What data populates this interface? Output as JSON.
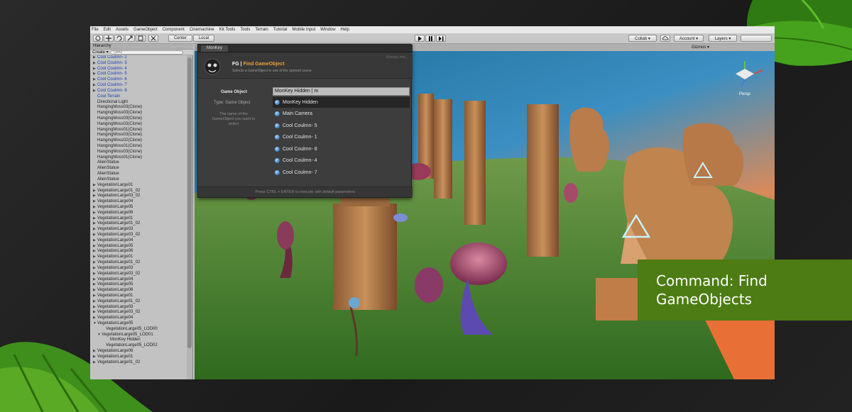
{
  "menubar": {
    "items": [
      "File",
      "Edit",
      "Assets",
      "GameObject",
      "Component",
      "Cinemachine",
      "Kit Tools",
      "Tools",
      "Terrain",
      "Tutorial",
      "Mobile Input",
      "Window",
      "Help"
    ]
  },
  "toolbar": {
    "center_label": "Center",
    "local_label": "Local",
    "collab_label": "Collab ▾",
    "account_label": "Account ▾",
    "layers_label": "Layers ▾",
    "layout_label": ""
  },
  "hierarchy": {
    "tab_label": "Hierarchy",
    "create_label": "Create ▾",
    "search_placeholder": "Q▾All",
    "rows": [
      {
        "label": "Cool Coulmn- 2",
        "indent": 1,
        "arrow": "right",
        "blue": true
      },
      {
        "label": "Cool Coulmn- 3",
        "indent": 1,
        "arrow": "right",
        "blue": true
      },
      {
        "label": "Cool Coulmn- 4",
        "indent": 1,
        "arrow": "right",
        "blue": true
      },
      {
        "label": "Cool Coulmn- 5",
        "indent": 1,
        "arrow": "right",
        "blue": true
      },
      {
        "label": "Cool Coulmn- 6",
        "indent": 1,
        "arrow": "right",
        "blue": true
      },
      {
        "label": "Cool Coulmn- 7",
        "indent": 1,
        "arrow": "right",
        "blue": true
      },
      {
        "label": "Cool Coulmn- 8",
        "indent": 1,
        "arrow": "right",
        "blue": true
      },
      {
        "label": "Cool Terrain",
        "indent": 1,
        "arrow": "",
        "blue": true
      },
      {
        "label": "Directional Light",
        "indent": 1,
        "arrow": "",
        "blue": false
      },
      {
        "label": "HangingMoss03(Clone)",
        "indent": 1,
        "arrow": "",
        "blue": false
      },
      {
        "label": "HangingMoss03(Clone)",
        "indent": 1,
        "arrow": "",
        "blue": false
      },
      {
        "label": "HangingMoss03(Clone)",
        "indent": 1,
        "arrow": "",
        "blue": false
      },
      {
        "label": "HangingMoss03(Clone)",
        "indent": 1,
        "arrow": "",
        "blue": false
      },
      {
        "label": "HangingMoss01(Clone)",
        "indent": 1,
        "arrow": "",
        "blue": false
      },
      {
        "label": "HangingMoss03(Clone)",
        "indent": 1,
        "arrow": "",
        "blue": false
      },
      {
        "label": "HangingMoss02(Clone)",
        "indent": 1,
        "arrow": "",
        "blue": false
      },
      {
        "label": "HangingMoss01(Clone)",
        "indent": 1,
        "arrow": "",
        "blue": false
      },
      {
        "label": "HangingMoss03(Clone)",
        "indent": 1,
        "arrow": "",
        "blue": false
      },
      {
        "label": "HangingMoss01(Clone)",
        "indent": 1,
        "arrow": "",
        "blue": false
      },
      {
        "label": "AlienStatue",
        "indent": 1,
        "arrow": "",
        "blue": false
      },
      {
        "label": "AlienStatue",
        "indent": 1,
        "arrow": "",
        "blue": false
      },
      {
        "label": "AlienStatue",
        "indent": 1,
        "arrow": "",
        "blue": false
      },
      {
        "label": "AlienStatue",
        "indent": 1,
        "arrow": "",
        "blue": false
      },
      {
        "label": "VegetationLarge01",
        "indent": 1,
        "arrow": "right",
        "blue": false
      },
      {
        "label": "VegetationLarge01_02",
        "indent": 1,
        "arrow": "right",
        "blue": false
      },
      {
        "label": "VegetationLarge03_02",
        "indent": 1,
        "arrow": "right",
        "blue": false
      },
      {
        "label": "VegetationLarge04",
        "indent": 1,
        "arrow": "right",
        "blue": false
      },
      {
        "label": "VegetationLarge05",
        "indent": 1,
        "arrow": "right",
        "blue": false
      },
      {
        "label": "VegetationLarge06",
        "indent": 1,
        "arrow": "right",
        "blue": false
      },
      {
        "label": "VegetationLarge01",
        "indent": 1,
        "arrow": "right",
        "blue": false
      },
      {
        "label": "VegetationLarge01_02",
        "indent": 1,
        "arrow": "right",
        "blue": false
      },
      {
        "label": "VegetationLarge03",
        "indent": 1,
        "arrow": "right",
        "blue": false
      },
      {
        "label": "VegetationLarge03_02",
        "indent": 1,
        "arrow": "right",
        "blue": false
      },
      {
        "label": "VegetationLarge04",
        "indent": 1,
        "arrow": "right",
        "blue": false
      },
      {
        "label": "VegetationLarge05",
        "indent": 1,
        "arrow": "right",
        "blue": false
      },
      {
        "label": "VegetationLarge06",
        "indent": 1,
        "arrow": "right",
        "blue": false
      },
      {
        "label": "VegetationLarge01",
        "indent": 1,
        "arrow": "right",
        "blue": false
      },
      {
        "label": "VegetationLarge01_02",
        "indent": 1,
        "arrow": "right",
        "blue": false
      },
      {
        "label": "VegetationLarge03",
        "indent": 1,
        "arrow": "right",
        "blue": false
      },
      {
        "label": "VegetationLarge03_02",
        "indent": 1,
        "arrow": "right",
        "blue": false
      },
      {
        "label": "VegetationLarge04",
        "indent": 1,
        "arrow": "right",
        "blue": false
      },
      {
        "label": "VegetationLarge05",
        "indent": 1,
        "arrow": "right",
        "blue": false
      },
      {
        "label": "VegetationLarge06",
        "indent": 1,
        "arrow": "right",
        "blue": false
      },
      {
        "label": "VegetationLarge01",
        "indent": 1,
        "arrow": "right",
        "blue": false
      },
      {
        "label": "VegetationLarge01_02",
        "indent": 1,
        "arrow": "right",
        "blue": false
      },
      {
        "label": "VegetationLarge03",
        "indent": 1,
        "arrow": "right",
        "blue": false
      },
      {
        "label": "VegetationLarge03_02",
        "indent": 1,
        "arrow": "right",
        "blue": false
      },
      {
        "label": "VegetationLarge04",
        "indent": 1,
        "arrow": "right",
        "blue": false
      },
      {
        "label": "VegetationLarge05",
        "indent": 1,
        "arrow": "down",
        "blue": false
      },
      {
        "label": "VegetationLarge05_LOD00",
        "indent": 3,
        "arrow": "",
        "blue": false
      },
      {
        "label": "VegetationLarge05_LOD01",
        "indent": 2,
        "arrow": "down",
        "blue": false
      },
      {
        "label": "MonKey Hidden",
        "indent": 4,
        "arrow": "",
        "blue": false
      },
      {
        "label": "VegetationLarge05_LOD02",
        "indent": 3,
        "arrow": "",
        "blue": false
      },
      {
        "label": "VegetationLarge06",
        "indent": 1,
        "arrow": "right",
        "blue": false
      },
      {
        "label": "VegetationLarge01",
        "indent": 1,
        "arrow": "right",
        "blue": false
      },
      {
        "label": "VegetationLarge01_02",
        "indent": 1,
        "arrow": "right",
        "blue": false
      }
    ]
  },
  "scene": {
    "gizmos_label": "Gizmos ▾",
    "persp_label": "Persp"
  },
  "popup": {
    "tab_label": "MonKey",
    "title_prefix": "FG | ",
    "title_main": "Find GameObject",
    "subtitle": "Selects a GameObject in one of the opened scene",
    "hint_top": "Monkey hint...",
    "field_label": "Game Object",
    "type_label": "Type: Game Object",
    "description": "The name of the GameObject you want to select",
    "input_value": "MonKey Hidden | m",
    "results": [
      {
        "label": "MonKey Hidden",
        "selected": true
      },
      {
        "label": "Main Camera",
        "selected": false
      },
      {
        "label": "Cool Coulmn- 5",
        "selected": false
      },
      {
        "label": "Cool Coulmn- 1",
        "selected": false
      },
      {
        "label": "Cool Coulmn- 8",
        "selected": false
      },
      {
        "label": "Cool Coulmn- 4",
        "selected": false
      },
      {
        "label": "Cool Coulmn- 7",
        "selected": false
      }
    ],
    "footer": "Press CTRL + ENTER to execute with default parameters"
  },
  "overlay": {
    "line1": "Command: Find",
    "line2": "GameObjects"
  },
  "colors": {
    "accent_green": "#4c7c13",
    "leaf_green": "#3e8f1b",
    "popup_accent": "#e8a23a",
    "hierarchy_blue": "#1b3fb2"
  },
  "icons": [
    "hand-tool-icon",
    "move-tool-icon",
    "rotate-tool-icon",
    "scale-tool-icon",
    "rect-tool-icon",
    "play-icon",
    "pause-icon",
    "step-icon",
    "cloud-icon",
    "monkey-logo-icon",
    "gameobject-icon"
  ]
}
